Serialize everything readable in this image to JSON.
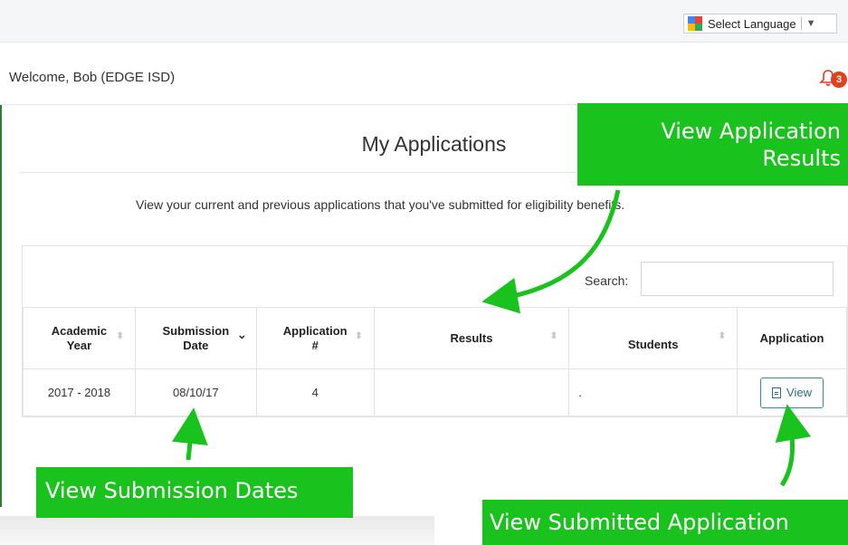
{
  "top_bar": {
    "language_select_label": "Select Language",
    "language_select_caret": "▼",
    "google_icon_colors": [
      "#4285F4",
      "#EA4335",
      "#FBBC05",
      "#34A853"
    ]
  },
  "header": {
    "welcome_text": "Welcome, Bob (EDGE ISD)",
    "notification_count": "3",
    "bell_color": "#e2411d"
  },
  "page": {
    "title": "My Applications",
    "subtitle": "View your current and previous applications that you've submitted for eligibility benefits."
  },
  "table": {
    "search_label": "Search:",
    "search_value": "",
    "columns": [
      {
        "label": "Academic\nYear",
        "sort": "sortable"
      },
      {
        "label": "Submission\nDate",
        "sort": "descending"
      },
      {
        "label": "Application\n#",
        "sort": "sortable"
      },
      {
        "label": "Results",
        "sort": "sortable"
      },
      {
        "label": "Students",
        "sort": "sortable"
      },
      {
        "label": "Application",
        "sort": "none"
      }
    ],
    "rows": [
      {
        "academic_year": "2017 - 2018",
        "submission_date": "08/10/17",
        "application_number": "4",
        "results": "",
        "students": ".",
        "view_button_label": "View"
      }
    ]
  },
  "callouts": {
    "results": "View Application\nResults",
    "dates": "View Submission Dates",
    "application": "View Submitted Application",
    "color": "#19c21c"
  }
}
